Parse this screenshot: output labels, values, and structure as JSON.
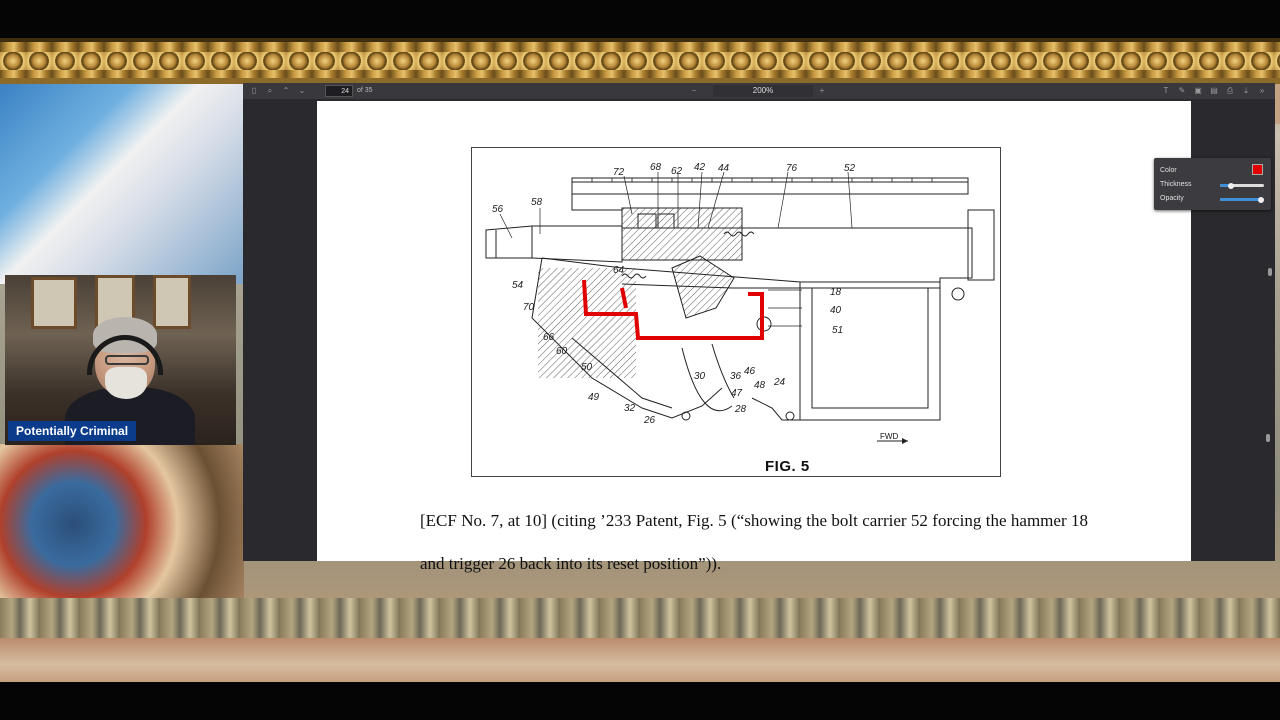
{
  "pdf_viewer": {
    "page_number": "24",
    "page_count": "of 35",
    "zoom": "200%"
  },
  "annotation_panel": {
    "color_label": "Color",
    "thickness_label": "Thickness",
    "opacity_label": "Opacity",
    "color_value": "#e30000",
    "thickness_level": 0.25,
    "opacity_level": 1.0
  },
  "figure": {
    "caption": "FIG. 5",
    "fwd_label": "FWD",
    "reference_numbers": [
      "72",
      "68",
      "62",
      "42",
      "44",
      "76",
      "52",
      "56",
      "58",
      "54",
      "64",
      "70",
      "66",
      "60",
      "50",
      "49",
      "32",
      "26",
      "30",
      "36",
      "47",
      "28",
      "46",
      "48",
      "24",
      "18",
      "40",
      "51"
    ]
  },
  "document": {
    "citation_text": "[ECF No. 7, at 10] (citing ’233 Patent, Fig. 5 (“showing the bolt carrier 52 forcing the hammer 18 and trigger 26 back into its reset position”))."
  },
  "webcam": {
    "name_tag": "Potentially Criminal"
  }
}
